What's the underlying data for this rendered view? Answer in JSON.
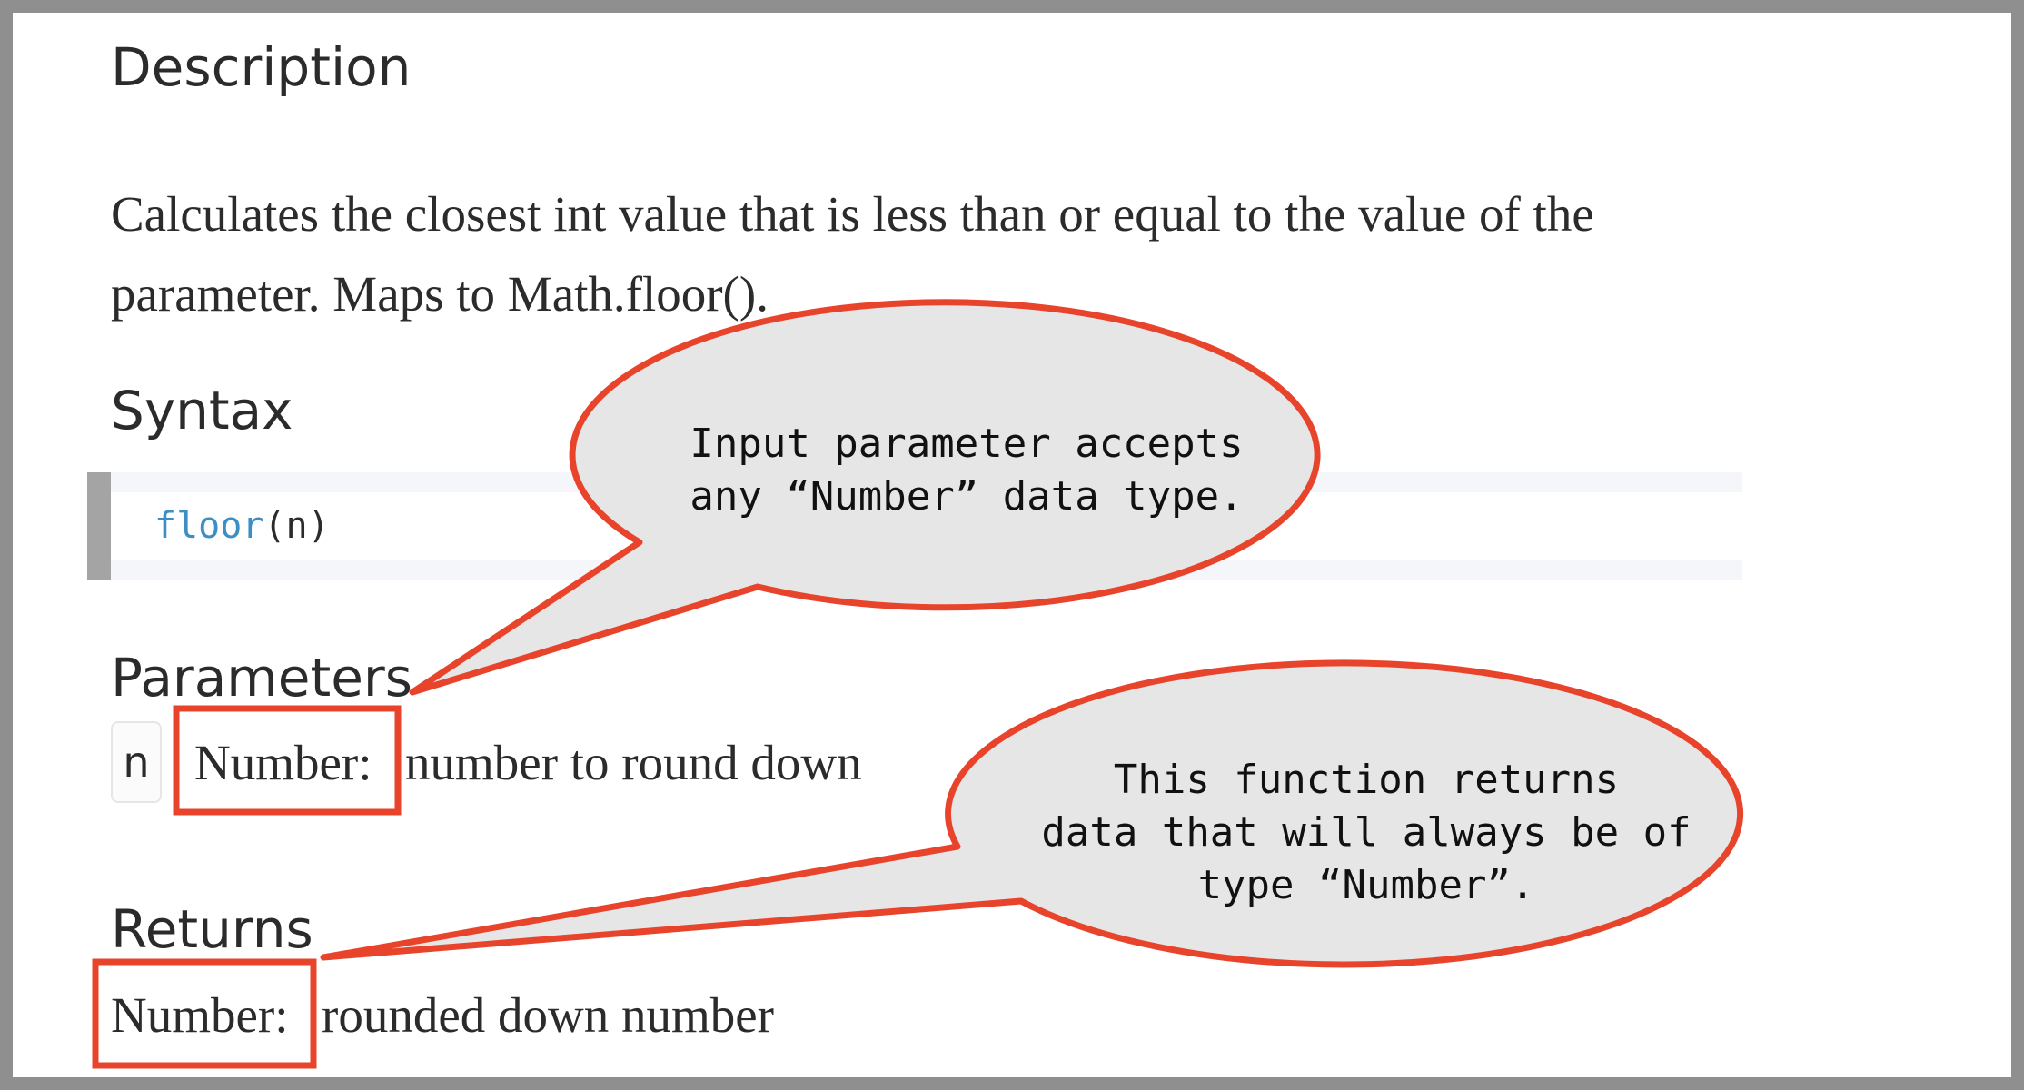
{
  "description": {
    "heading": "Description",
    "text": "Calculates the closest int value that is less than or equal to the value of the parameter. Maps to Math.floor()."
  },
  "syntax": {
    "heading": "Syntax",
    "function_name": "floor",
    "open_paren": "(",
    "argument": "n",
    "close_paren": ")"
  },
  "parameters": {
    "heading": "Parameters",
    "items": [
      {
        "name": "n",
        "type": "Number:",
        "description": "number to round down"
      }
    ]
  },
  "returns": {
    "heading": "Returns",
    "type": "Number:",
    "description": "rounded down number"
  },
  "callouts": [
    {
      "lines": [
        "Input parameter accepts",
        "any “Number” data type."
      ]
    },
    {
      "lines": [
        "This function returns",
        "data that will always be of",
        "type “Number”."
      ]
    }
  ],
  "colors": {
    "callout_border": "#e8442c",
    "callout_fill": "#e6e6e6",
    "code_function": "#3c8fc4",
    "code_bar": "#a4a4a4",
    "frame": "#8f8f8f"
  }
}
